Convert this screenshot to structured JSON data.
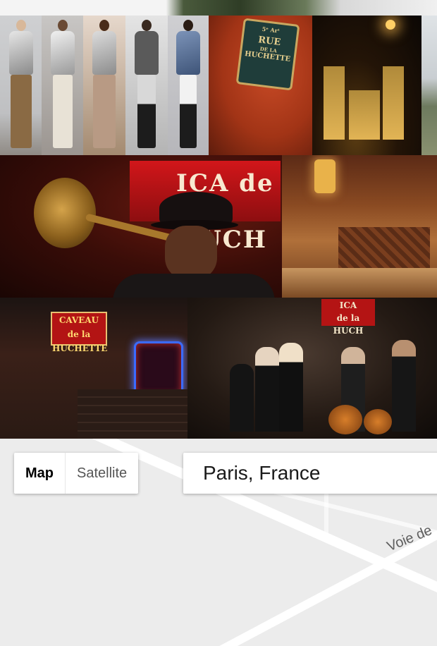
{
  "collage": {
    "top_row": [
      "runway-look-1",
      "runway-look-2",
      "runway-look-3",
      "runway-look-4",
      "runway-look-5",
      "rue-de-la-huchette-sign",
      "notre-dame-at-night",
      "airport"
    ],
    "middle_row": [
      "jazz-trumpeter",
      "bar-interior"
    ],
    "bottom_row": [
      "caveau-de-la-huchette-facade",
      "jazz-band-on-stage"
    ],
    "sign_text": {
      "line1": "5ᵉ Arᵗ",
      "line2": "RUE",
      "line3": "DE LA",
      "line4": "HUCHETTE"
    },
    "neon_text": "ICA de la HUCH",
    "caveau_sign": {
      "line1": "CAVEAU de la",
      "line2": "HUCHETTE"
    },
    "stage_sign": {
      "line1": "ICA",
      "line2": "de la HUCH"
    }
  },
  "map": {
    "type_control": {
      "map_label": "Map",
      "satellite_label": "Satellite",
      "selected": "Map"
    },
    "search": {
      "value": "Paris, France"
    },
    "road_label": "Voie de"
  },
  "colors": {
    "map_background": "#ececec",
    "road": "#ffffff",
    "control_bg": "#ffffff"
  }
}
